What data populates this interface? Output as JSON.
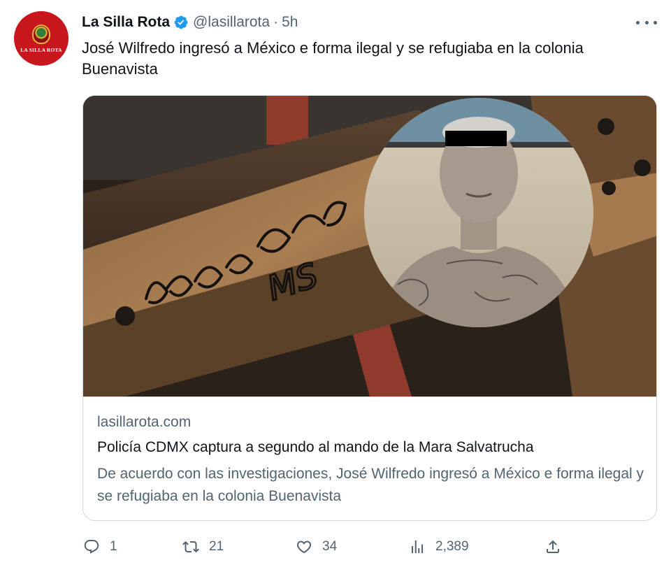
{
  "author": {
    "display_name": "La Silla Rota",
    "avatar_text": "LA SILLA ROTA",
    "handle": "@lasillarota",
    "separator": "·",
    "time": "5h",
    "verified_color": "#1d9bf0"
  },
  "tweet": {
    "text": "José Wilfredo ingresó a México e forma ilegal y se refugiaba en la colonia Buenavista"
  },
  "card": {
    "domain": "lasillarota.com",
    "title": "Policía CDMX captura a segundo al mando de la Mara Salvatrucha",
    "description": "De acuerdo con las investigaciones, José Wilfredo ingresó a México e forma ilegal y se refugiaba en la colonia Buenavista",
    "image_graffiti": "MS"
  },
  "actions": {
    "reply": {
      "icon": "reply-icon",
      "count": "1"
    },
    "retweet": {
      "icon": "retweet-icon",
      "count": "21"
    },
    "like": {
      "icon": "heart-icon",
      "count": "34"
    },
    "views": {
      "icon": "views-icon",
      "count": "2,389"
    },
    "share": {
      "icon": "share-icon"
    }
  },
  "colors": {
    "text_primary": "#0f1419",
    "text_secondary": "#536471",
    "border": "#cfd9de",
    "brand_red": "#c8161d"
  }
}
